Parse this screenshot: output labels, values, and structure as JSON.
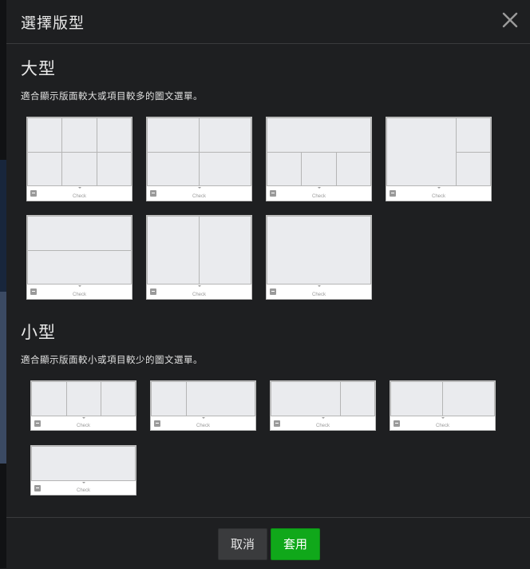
{
  "dialog": {
    "title": "選擇版型",
    "close_icon": "close-icon"
  },
  "large": {
    "title": "大型",
    "description": "適合顯示版面較大或項目較多的圖文選單。",
    "templates": [
      {
        "name": "large-6-grid",
        "bar_text": "Check"
      },
      {
        "name": "large-4-grid",
        "bar_text": "Check"
      },
      {
        "name": "large-1-top-3-bottom",
        "bar_text": "Check"
      },
      {
        "name": "large-1-left-2-right",
        "bar_text": "Check"
      },
      {
        "name": "large-2-rows",
        "bar_text": "Check"
      },
      {
        "name": "large-2-columns",
        "bar_text": "Check"
      },
      {
        "name": "large-1-full",
        "bar_text": "Check"
      }
    ]
  },
  "small": {
    "title": "小型",
    "description": "適合顯示版面較小或項目較少的圖文選單。",
    "templates": [
      {
        "name": "small-3-columns",
        "bar_text": "Check"
      },
      {
        "name": "small-1-narrow-1-wide",
        "bar_text": "Check"
      },
      {
        "name": "small-1-wide-1-narrow",
        "bar_text": "Check"
      },
      {
        "name": "small-2-columns",
        "bar_text": "Check"
      },
      {
        "name": "small-1-full",
        "bar_text": "Check"
      }
    ]
  },
  "footer": {
    "cancel_label": "取消",
    "apply_label": "套用"
  },
  "colors": {
    "apply_button": "#10a81a",
    "background": "#1e1f21",
    "tile_fill": "#eaebee"
  }
}
